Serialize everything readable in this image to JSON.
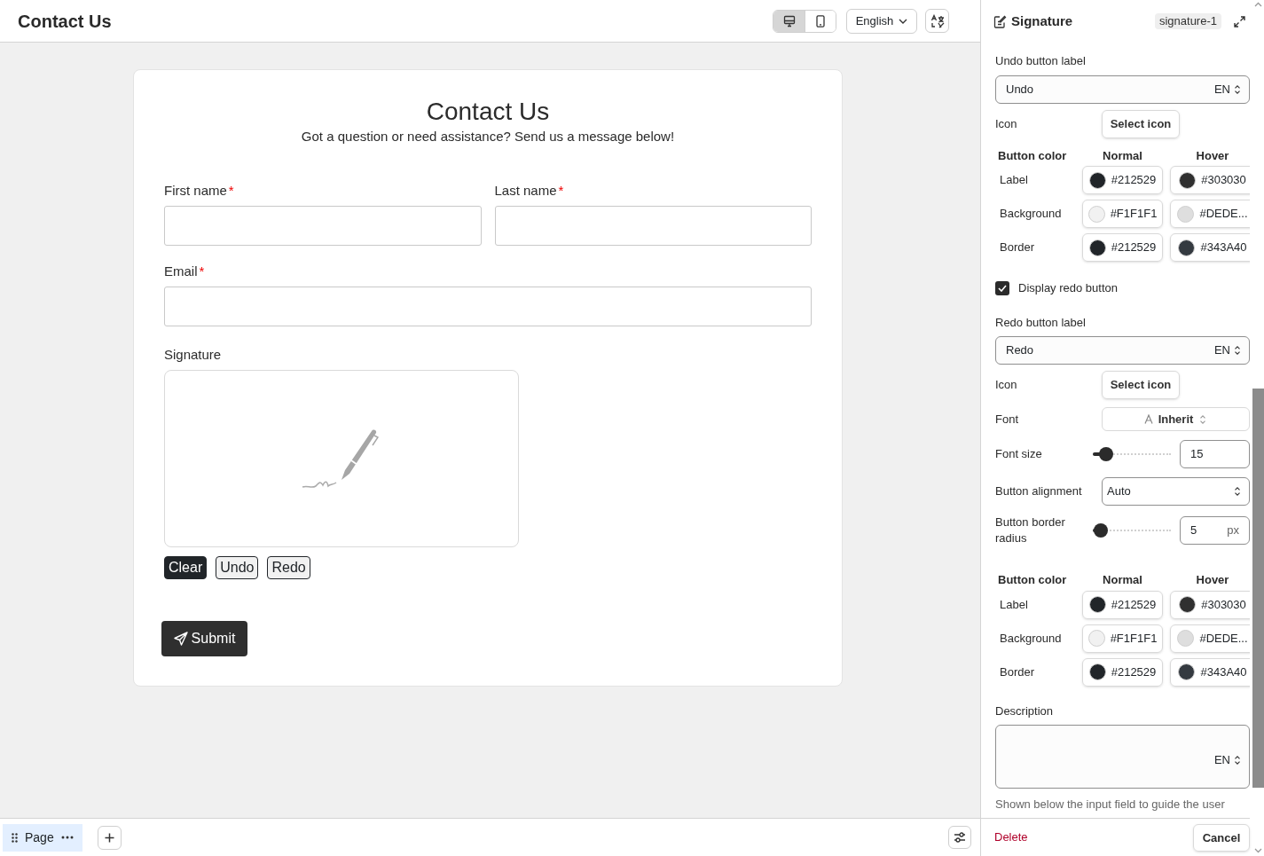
{
  "topbar": {
    "title": "Contact Us",
    "devices": [
      {
        "kind": "desktop",
        "selected": true
      },
      {
        "kind": "mobile",
        "selected": false
      }
    ],
    "language": "English"
  },
  "form": {
    "title": "Contact Us",
    "subtitle": "Got a question or need assistance? Send us a message below!",
    "name_fields": [
      {
        "label": "First name",
        "required_mark": "*"
      },
      {
        "label": "Last name",
        "required_mark": "*"
      }
    ],
    "email": {
      "label": "Email",
      "required_mark": "*"
    },
    "signature": {
      "label": "Signature",
      "buttons": [
        {
          "label": "Clear",
          "kind": "primary"
        },
        {
          "label": "Undo",
          "kind": "outline"
        },
        {
          "label": "Redo",
          "kind": "outline"
        }
      ]
    },
    "submit": "Submit"
  },
  "panel": {
    "title": "Signature",
    "badge": "signature-1",
    "items": [
      {
        "kind": "text_field",
        "label": "Undo button label",
        "value": "Undo",
        "lang": "EN"
      },
      {
        "kind": "button_row",
        "label": "Icon",
        "button": "Select icon"
      },
      {
        "kind": "color_table",
        "headers": [
          "Button color",
          "Normal",
          "Hover"
        ],
        "rows": [
          {
            "label": "Label",
            "normal": {
              "color": "#212529",
              "text": "#212529"
            },
            "hover": {
              "color": "#303030",
              "text": "#303030"
            }
          },
          {
            "label": "Background",
            "normal": {
              "color": "#f1f1f1",
              "text": "#F1F1F1"
            },
            "hover": {
              "color": "#dedede",
              "text": "#DEDE..."
            }
          },
          {
            "label": "Border",
            "normal": {
              "color": "#212529",
              "text": "#212529"
            },
            "hover": {
              "color": "#343a40",
              "text": "#343A40"
            }
          }
        ]
      },
      {
        "kind": "checkbox",
        "label": "Display redo button",
        "checked": true
      },
      {
        "kind": "text_field",
        "label": "Redo button label",
        "value": "Redo",
        "lang": "EN"
      },
      {
        "kind": "button_row",
        "label": "Icon",
        "button": "Select icon"
      },
      {
        "kind": "font",
        "label": "Font",
        "value": "Inherit"
      },
      {
        "kind": "slider",
        "label": "Font size",
        "level": 0.12,
        "value": "15"
      },
      {
        "kind": "select",
        "label": "Button alignment",
        "value": "Auto"
      },
      {
        "kind": "slider",
        "label": "Button border radius",
        "level": 0.06,
        "value": "5",
        "unit": "px"
      },
      {
        "kind": "color_table",
        "headers": [
          "Button color",
          "Normal",
          "Hover"
        ],
        "rows": [
          {
            "label": "Label",
            "normal": {
              "color": "#212529",
              "text": "#212529"
            },
            "hover": {
              "color": "#303030",
              "text": "#303030"
            }
          },
          {
            "label": "Background",
            "normal": {
              "color": "#f1f1f1",
              "text": "#F1F1F1"
            },
            "hover": {
              "color": "#dedede",
              "text": "#DEDE..."
            }
          },
          {
            "label": "Border",
            "normal": {
              "color": "#212529",
              "text": "#212529"
            },
            "hover": {
              "color": "#343a40",
              "text": "#343A40"
            }
          }
        ]
      },
      {
        "kind": "textarea",
        "label": "Description",
        "lang": "EN",
        "help": "Shown below the input field to guide the user"
      }
    ],
    "delete": "Delete",
    "cancel": "Cancel"
  },
  "bottombar": {
    "page_tab": {
      "label": "Page",
      "selected": true
    }
  }
}
